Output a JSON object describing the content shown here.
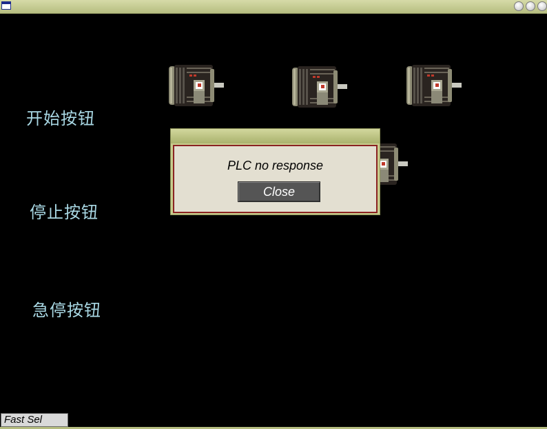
{
  "window": {
    "close_icon": "circle-button",
    "buttons": [
      "minimize",
      "maximize",
      "close"
    ]
  },
  "labels": {
    "start": "开始按钮",
    "stop": "停止按钮",
    "emergency_stop": "急停按钮"
  },
  "motors": [
    "motor-1",
    "motor-2",
    "motor-3",
    "motor-4"
  ],
  "dialog": {
    "message": "PLC no response",
    "close_label": "Close"
  },
  "footer": {
    "fast_sel_label": "Fast Sel"
  },
  "colors": {
    "background": "#000000",
    "titlebar": "#c8cc8e",
    "label_text": "#a9d8e4",
    "dialog_border": "#8b2222",
    "dialog_body": "#e3dfd1"
  }
}
